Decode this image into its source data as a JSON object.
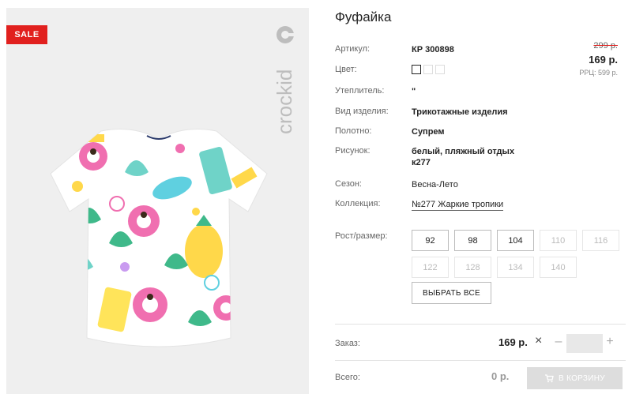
{
  "badge": {
    "sale": "SALE"
  },
  "brand": {
    "logo": "crockid"
  },
  "product": {
    "title": "Фуфайка",
    "specs": {
      "article": {
        "label": "Артикул:",
        "value": "КР 300898"
      },
      "color": {
        "label": "Цвет:"
      },
      "insulation": {
        "label": "Утеплитель:",
        "value": "\""
      },
      "type": {
        "label": "Вид изделия:",
        "value": "Трикотажные изделия"
      },
      "fabric": {
        "label": "Полотно:",
        "value": "Супрем"
      },
      "pattern": {
        "label": "Рисунок:",
        "value": "белый, пляжный отдых к277"
      },
      "season": {
        "label": "Сезон:",
        "value": "Весна-Лето"
      },
      "collection": {
        "label": "Коллекция:",
        "value": "№277 Жаркие тропики"
      }
    }
  },
  "price": {
    "old": "299 р.",
    "current": "169 р.",
    "rrp": "РРЦ: 599 р."
  },
  "sizes": {
    "label": "Рост/размер:",
    "options": [
      {
        "value": "92",
        "available": true
      },
      {
        "value": "98",
        "available": true
      },
      {
        "value": "104",
        "available": true
      },
      {
        "value": "110",
        "available": false
      },
      {
        "value": "116",
        "available": false
      },
      {
        "value": "122",
        "available": false
      },
      {
        "value": "128",
        "available": false
      },
      {
        "value": "134",
        "available": false
      },
      {
        "value": "140",
        "available": false
      }
    ],
    "select_all": "ВЫБРАТЬ ВСЕ"
  },
  "order": {
    "label": "Заказ:",
    "price": "169 р.",
    "multiply": "×",
    "minus": "–",
    "plus": "+",
    "quantity": ""
  },
  "total": {
    "label": "Всего:",
    "value": "0 р.",
    "cart_button": "В КОРЗИНУ"
  },
  "colors": {
    "sale": "#e1201e",
    "cart_disabled": "#dddddd"
  }
}
